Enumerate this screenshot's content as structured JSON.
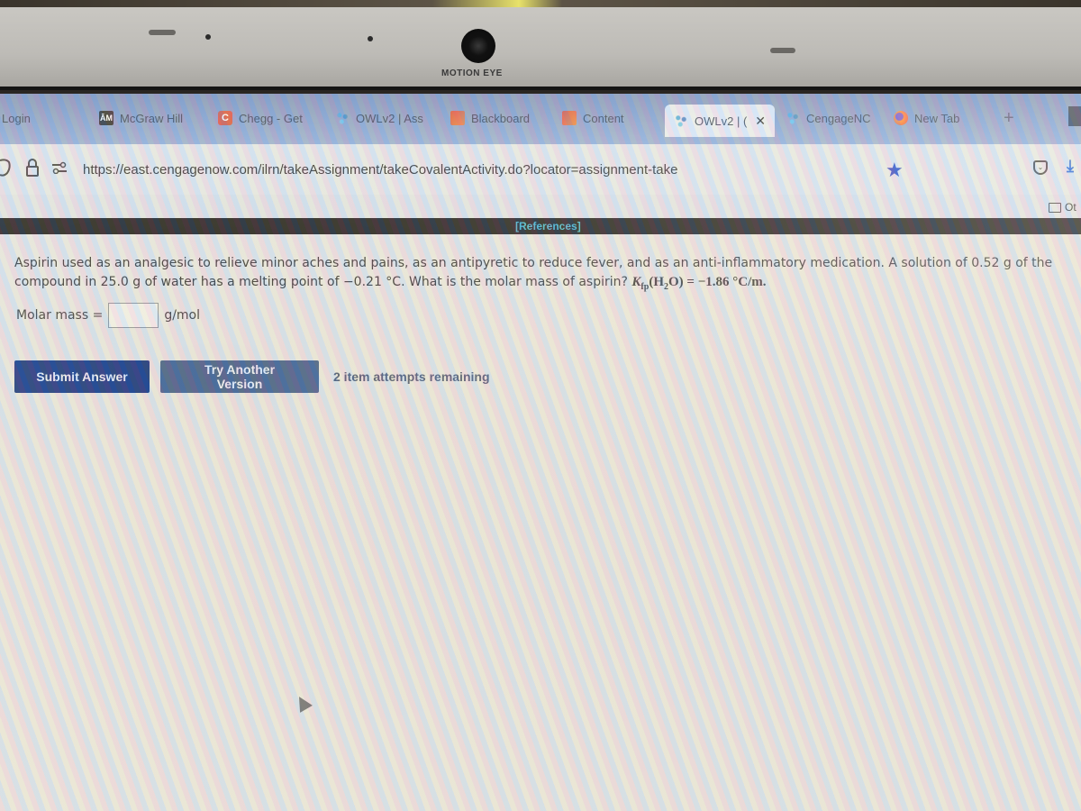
{
  "device": {
    "camera_label": "MOTION EYE"
  },
  "browser": {
    "tabs": [
      {
        "label": "Login",
        "icon": "none",
        "active": false
      },
      {
        "label": "McGraw Hill",
        "icon": "tamu-logo",
        "active": false
      },
      {
        "label": "Chegg - Get",
        "icon": "chegg-logo",
        "active": false
      },
      {
        "label": "OWLv2 | Ass",
        "icon": "owl-logo",
        "active": false
      },
      {
        "label": "Blackboard",
        "icon": "blackboard-logo",
        "active": false
      },
      {
        "label": "Content",
        "icon": "blackboard-logo",
        "active": false
      },
      {
        "label": "OWLv2 | (",
        "icon": "owl-logo",
        "active": true
      },
      {
        "label": "CengageNC",
        "icon": "owl-logo",
        "active": false
      },
      {
        "label": "New Tab",
        "icon": "firefox-logo",
        "active": false
      }
    ],
    "new_tab_symbol": "+",
    "close_symbol": "✕",
    "url": "https://east.cengagenow.com/ilrn/takeAssignment/takeCovalentActivity.do?locator=assignment-take",
    "bookmarks_other_label": "Ot"
  },
  "page": {
    "references_label": "[References]",
    "question_text": "Aspirin used as an analgesic to relieve minor aches and pains, as an antipyretic to reduce fever, and as an anti-inflammatory medication. A solution of 0.52 g of the compound in 25.0 g of water has a melting point of −0.21 °C. What is the molar mass of aspirin?",
    "constant": {
      "symbol": "K",
      "subscript": "fp",
      "species_prefix": "(H",
      "species_sub": "2",
      "species_suffix": "O)",
      "value_text": " = −1.86 °C/m."
    },
    "answer": {
      "label": "Molar mass =",
      "value": "",
      "unit": "g/mol"
    },
    "submit_label": "Submit Answer",
    "try_another_label": "Try Another Version",
    "attempts_text": "2 item attempts remaining"
  }
}
